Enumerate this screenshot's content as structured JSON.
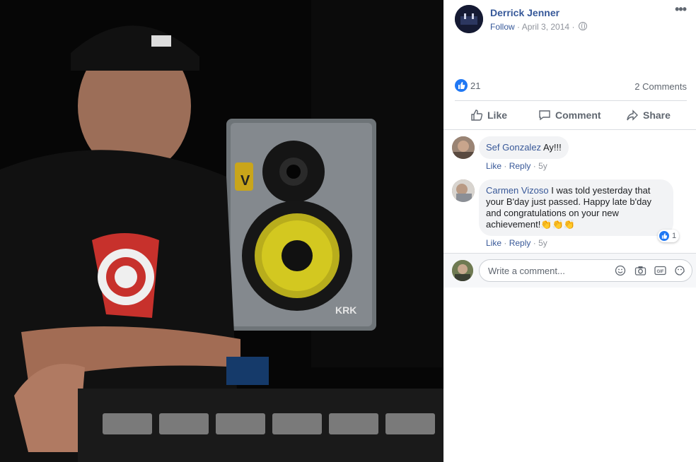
{
  "post": {
    "author": "Derrick Jenner",
    "follow": "Follow",
    "separator": "·",
    "date": "April 3, 2014",
    "more": "•••"
  },
  "stats": {
    "like_count": "21",
    "comments_count": "2 Comments"
  },
  "actions": {
    "like": "Like",
    "comment": "Comment",
    "share": "Share"
  },
  "comments": [
    {
      "name": "Sef Gonzalez",
      "text": "Ay!!!",
      "like": "Like",
      "reply": "Reply",
      "age": "5y"
    },
    {
      "name": "Carmen Vizoso",
      "text_lines": [
        "I was told yesterday that",
        "your B'day just passed. Happy late b'day",
        "and congratulations on your new",
        "achievement!👏👏👏"
      ],
      "like": "Like",
      "reply": "Reply",
      "age": "5y",
      "reaction_count": "1"
    }
  ],
  "composer": {
    "placeholder": "Write a comment...",
    "gif": "GIF"
  },
  "colors": {
    "link": "#365899",
    "like_blue": "#2078f4",
    "muted": "#90949c"
  },
  "icons": [
    "like-icon",
    "comment-icon",
    "share-icon",
    "globe-icon",
    "emoji-icon",
    "camera-icon",
    "gif-icon",
    "sticker-icon",
    "more-icon"
  ]
}
